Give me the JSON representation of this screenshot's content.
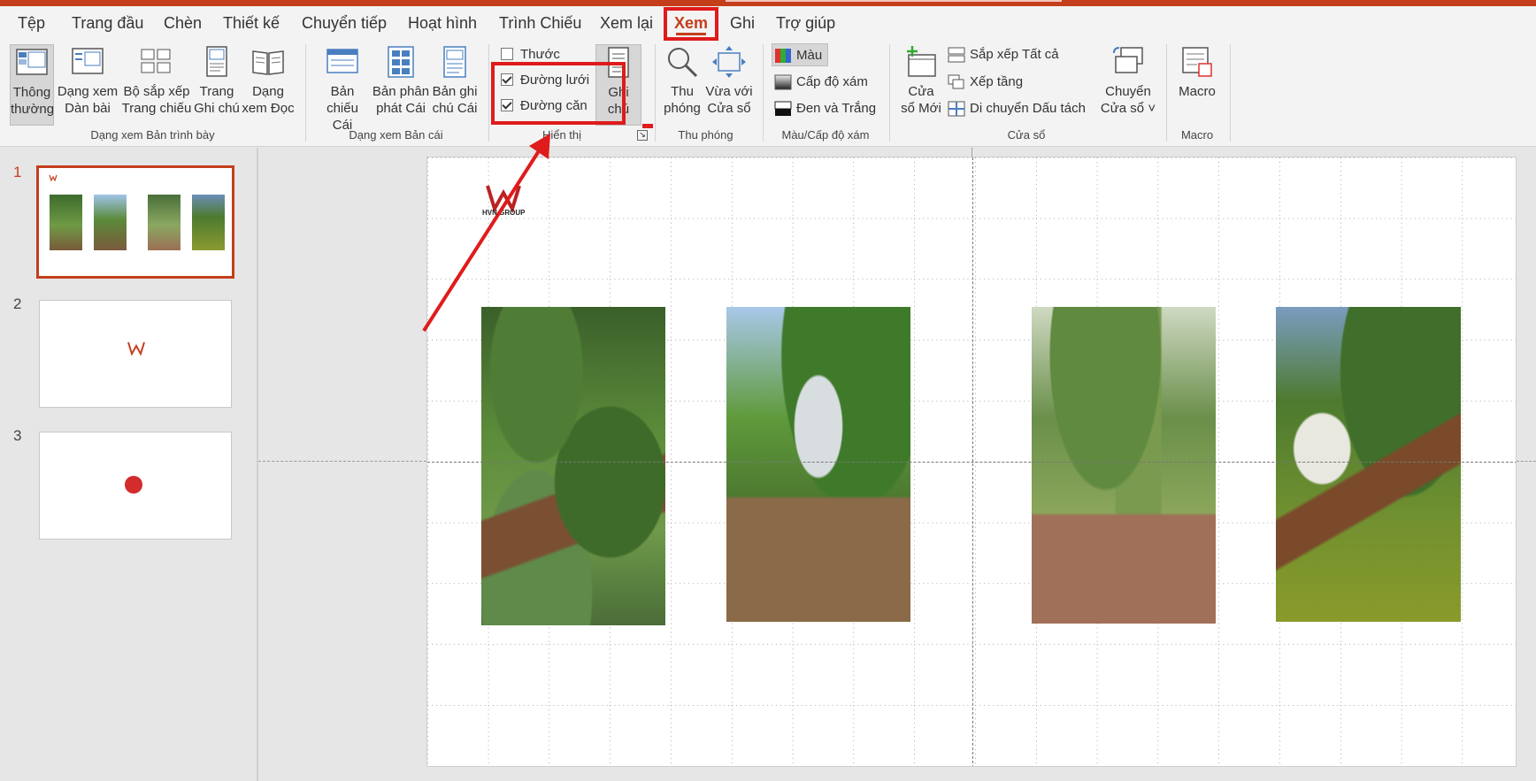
{
  "tabs": [
    {
      "label": "Tệp",
      "active": false
    },
    {
      "label": "Trang đầu",
      "active": false
    },
    {
      "label": "Chèn",
      "active": false
    },
    {
      "label": "Thiết kế",
      "active": false
    },
    {
      "label": "Chuyển tiếp",
      "active": false
    },
    {
      "label": "Hoạt hình",
      "active": false
    },
    {
      "label": "Trình Chiếu",
      "active": false
    },
    {
      "label": "Xem lại",
      "active": false
    },
    {
      "label": "Xem",
      "active": true
    },
    {
      "label": "Ghi",
      "active": false
    },
    {
      "label": "Trợ giúp",
      "active": false
    }
  ],
  "ribbon": {
    "presentation_views": {
      "label": "Dạng xem Bản trình bày",
      "buttons": [
        {
          "line1": "Thông",
          "line2": "thường",
          "icon": "normal-view-icon",
          "pressed": true
        },
        {
          "line1": "Dạng xem",
          "line2": "Dàn bài",
          "icon": "outline-view-icon"
        },
        {
          "line1": "Bộ sắp xếp",
          "line2": "Trang chiếu",
          "icon": "slide-sorter-icon"
        },
        {
          "line1": "Trang",
          "line2": "Ghi chú",
          "icon": "notes-page-icon"
        },
        {
          "line1": "Dạng",
          "line2": "xem Đọc",
          "icon": "reading-view-icon"
        }
      ]
    },
    "master_views": {
      "label": "Dạng xem Bản cái",
      "buttons": [
        {
          "line1": "Bản",
          "line2": "chiếu Cái",
          "icon": "slide-master-icon"
        },
        {
          "line1": "Bản phân",
          "line2": "phát Cái",
          "icon": "handout-master-icon"
        },
        {
          "line1": "Bản ghi",
          "line2": "chú Cái",
          "icon": "notes-master-icon"
        }
      ]
    },
    "show": {
      "label": "Hiển thị",
      "ruler": {
        "label": "Thước",
        "checked": false
      },
      "gridlines": {
        "label": "Đường lưới",
        "checked": true
      },
      "guides": {
        "label": "Đường căn",
        "checked": true
      },
      "notes_button": {
        "line1": "Ghi",
        "line2": "chú"
      }
    },
    "zoom": {
      "label": "Thu phóng",
      "zoom_button": {
        "line1": "Thu",
        "line2": "phóng"
      },
      "fit_button": {
        "line1": "Vừa với",
        "line2": "Cửa sổ"
      }
    },
    "color": {
      "label": "Màu/Cấp độ xám",
      "color": "Màu",
      "grayscale": "Cấp độ xám",
      "bw": "Đen và Trắng"
    },
    "window": {
      "label": "Cửa sổ",
      "new_window": {
        "line1": "Cửa",
        "line2": "sổ Mới"
      },
      "arrange_all": "Sắp xếp Tất cả",
      "cascade": "Xếp tầng",
      "move_split": "Di chuyển Dấu tách",
      "switch_windows": {
        "line1": "Chuyển",
        "line2": "Cửa sổ ˅"
      }
    },
    "macros": {
      "label": "Macro",
      "button": "Macro"
    }
  },
  "thumbnails": [
    {
      "number": "1",
      "selected": true
    },
    {
      "number": "2",
      "selected": false
    },
    {
      "number": "3",
      "selected": false
    }
  ],
  "slide": {
    "logo_text": "HVN GROUP"
  },
  "colors": {
    "accent": "#c43e1c",
    "annotation_red": "#e01b1b"
  }
}
